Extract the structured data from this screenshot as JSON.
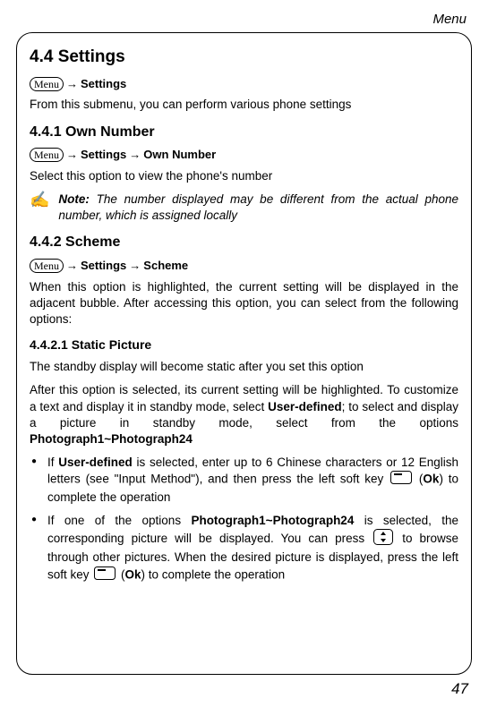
{
  "header": {
    "section_name": "Menu"
  },
  "page_number": "47",
  "menu_label": "Menu",
  "arrow": "→",
  "s44": {
    "title": "4.4 Settings",
    "nav": {
      "p1": "Settings"
    },
    "intro": "From this submenu, you can perform various phone settings"
  },
  "s441": {
    "title": "4.4.1 Own Number",
    "nav": {
      "p1": "Settings",
      "p2": "Own Number"
    },
    "intro": "Select this option to view the phone's number",
    "note_label": "Note:",
    "note_body": " The number displayed may be different from the actual phone number, which is assigned locally"
  },
  "s442": {
    "title": "4.4.2 Scheme",
    "nav": {
      "p1": "Settings",
      "p2": "Scheme"
    },
    "intro": "When this option is highlighted, the current setting will be displayed in the adjacent bubble. After accessing this option, you can select from the following options:"
  },
  "s4421": {
    "title": "4.4.2.1 Static Picture",
    "p1": "The standby display will become static after you set this option",
    "p2a": "After this option is selected, its current setting will be highlighted. To customize a text and display it in standby mode, select ",
    "p2b": "User-defined",
    "p2c": "; to select and display a picture in standby mode, select from the options ",
    "p2d": "Photograph1~Photograph24",
    "b1a": "If ",
    "b1b": "User-defined",
    "b1c": " is selected, enter up to 6 Chinese characters or 12 English letters (see \"Input Method\"), and then press the left soft key ",
    "b1d": " (",
    "b1e": "Ok",
    "b1f": ") to complete the operation",
    "b2a": "If one of the options ",
    "b2b": "Photograph1~Photograph24",
    "b2c": " is selected, the corresponding picture will be displayed. You can press ",
    "b2d": " to browse through other pictures. When the desired picture is displayed, press the left soft key ",
    "b2e": " (",
    "b2f": "Ok",
    "b2g": ") to complete the operation"
  }
}
